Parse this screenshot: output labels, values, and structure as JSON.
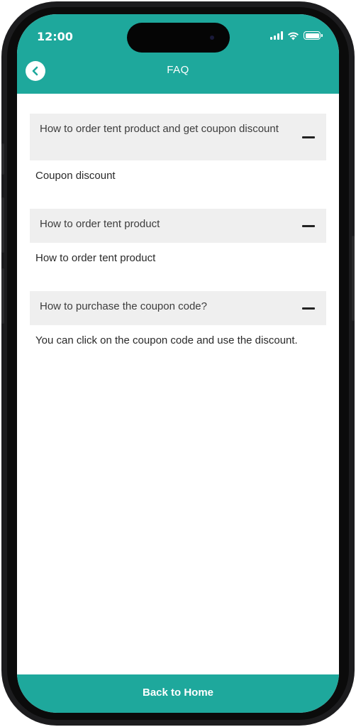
{
  "status_bar": {
    "time": "12:00"
  },
  "header": {
    "title": "FAQ"
  },
  "faq": [
    {
      "question": "How to order tent product and get coupon discount",
      "answer": "Coupon discount"
    },
    {
      "question": "How to order tent product",
      "answer": "How to order tent product"
    },
    {
      "question": "How to purchase the coupon code?",
      "answer": "You can click on the coupon code and use the discount."
    }
  ],
  "footer": {
    "button_label": "Back to Home"
  },
  "colors": {
    "accent": "#1ea89c",
    "question_bg": "#efefef"
  },
  "icons": [
    "back-arrow-icon",
    "signal-icon",
    "wifi-icon",
    "battery-icon",
    "collapse-minus-icon"
  ]
}
